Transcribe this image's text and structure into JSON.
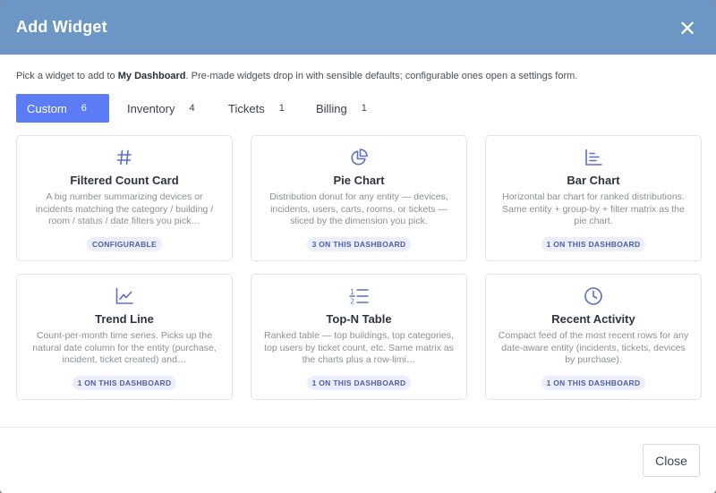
{
  "modal": {
    "title": "Add Widget",
    "close_icon": "close-icon"
  },
  "description": {
    "prefix": "Pick a widget to add to ",
    "dashboard_name": "My Dashboard",
    "suffix": ". Pre-made widgets drop in with sensible defaults; configurable ones open a settings form."
  },
  "tabs": [
    {
      "label": "Custom",
      "count": "6",
      "active": true
    },
    {
      "label": "Inventory",
      "count": "4",
      "active": false
    },
    {
      "label": "Tickets",
      "count": "1",
      "active": false
    },
    {
      "label": "Billing",
      "count": "1",
      "active": false
    }
  ],
  "widgets": [
    {
      "icon": "hash-icon",
      "title": "Filtered Count Card",
      "description": "A big number summarizing devices or incidents matching the category / building / room / status / date filters you pick…",
      "badge": "CONFIGURABLE"
    },
    {
      "icon": "pie-chart-icon",
      "title": "Pie Chart",
      "description": "Distribution donut for any entity — devices, incidents, users, carts, rooms, or tickets — sliced by the dimension you pick.",
      "badge": "3 ON THIS DASHBOARD"
    },
    {
      "icon": "bar-chart-icon",
      "title": "Bar Chart",
      "description": "Horizontal bar chart for ranked distributions. Same entity + group-by + filter matrix as the pie chart.",
      "badge": "1 ON THIS DASHBOARD"
    },
    {
      "icon": "trend-line-icon",
      "title": "Trend Line",
      "description": "Count-per-month time series. Picks up the natural date column for the entity (purchase, incident, ticket created) and…",
      "badge": "1 ON THIS DASHBOARD"
    },
    {
      "icon": "ordered-list-icon",
      "title": "Top-N Table",
      "description": "Ranked table — top buildings, top categories, top users by ticket count, etc. Same matrix as the charts plus a row-limi…",
      "badge": "1 ON THIS DASHBOARD"
    },
    {
      "icon": "clock-icon",
      "title": "Recent Activity",
      "description": "Compact feed of the most recent rows for any date-aware entity (incidents, tickets, devices by purchase).",
      "badge": "1 ON THIS DASHBOARD"
    }
  ],
  "footer": {
    "close_label": "Close"
  },
  "colors": {
    "header": "#6c96c4",
    "accent": "#5b7cf4",
    "icon": "#5b6fc8",
    "badge_bg": "#eceffb"
  }
}
